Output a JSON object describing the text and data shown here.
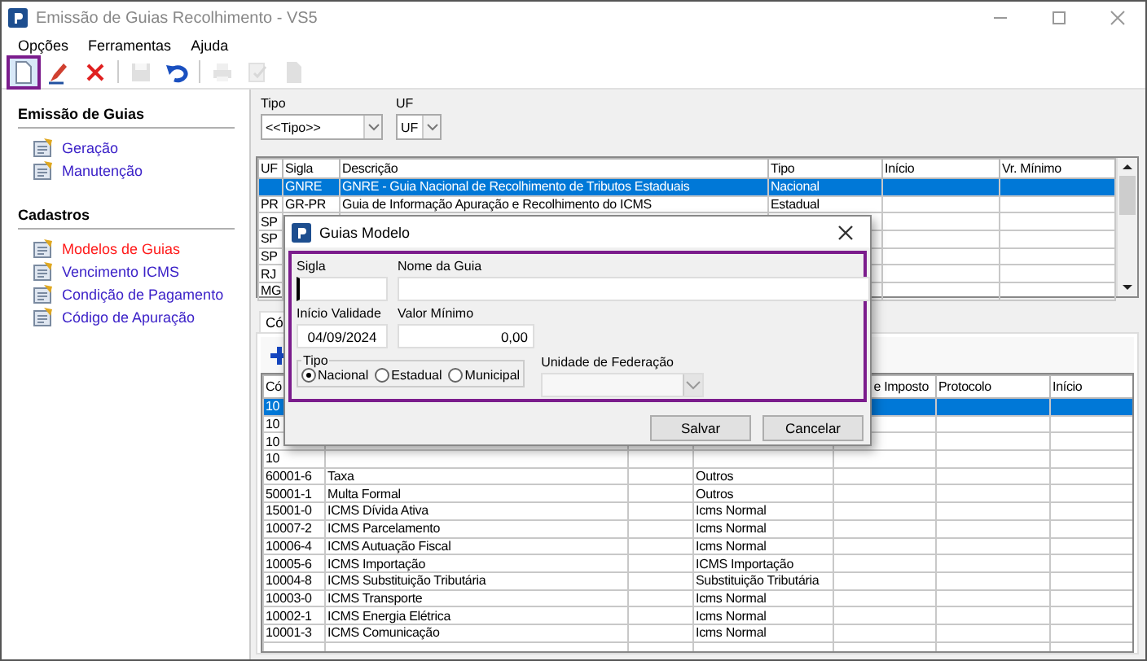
{
  "window": {
    "title": "Emissão de Guias Recolhimento - VS5"
  },
  "menu": [
    "Opções",
    "Ferramentas",
    "Ajuda"
  ],
  "toolbar": [
    {
      "disabled": false,
      "highlighted": true
    },
    {
      "disabled": false,
      "highlighted": false
    },
    {
      "disabled": false,
      "highlighted": false
    },
    {
      "disabled": true,
      "highlighted": false
    },
    {
      "disabled": false,
      "highlighted": false
    },
    {
      "disabled": true,
      "highlighted": false
    },
    {
      "disabled": true,
      "highlighted": false
    },
    {
      "disabled": true,
      "highlighted": false
    }
  ],
  "sidebar": [
    {
      "title": "Emissão de Guias",
      "items": [
        {
          "label": "Geração",
          "selected": false
        },
        {
          "label": "Manutenção",
          "selected": false
        }
      ]
    },
    {
      "title": "Cadastros",
      "items": [
        {
          "label": "Modelos de Guias",
          "selected": true
        },
        {
          "label": "Vencimento ICMS",
          "selected": false
        },
        {
          "label": "Condição de Pagamento",
          "selected": false
        },
        {
          "label": "Código de Apuração",
          "selected": false
        }
      ]
    }
  ],
  "filters": [
    {
      "label": "Tipo",
      "value": "<<Tipo>>"
    },
    {
      "label": "UF",
      "value": "UF"
    }
  ],
  "guides_table": {
    "columns": [
      "UF",
      "Sigla",
      "Descrição",
      "Tipo",
      "Início",
      "Vr. Mínimo"
    ],
    "rows": [
      {
        "sigla": "GNRE",
        "descricao": "GNRE - Guia Nacional de Recolhimento de Tributos Estaduais",
        "tipo": "Nacional",
        "selected": true
      },
      {
        "uf": "PR",
        "sigla": "GR-PR",
        "descricao": "Guia de Informação Apuração e Recolhimento do ICMS",
        "tipo": "Estadual",
        "selected": false
      },
      {
        "uf": "SP",
        "selected": false
      },
      {
        "uf": "SP",
        "selected": false
      },
      {
        "uf": "SP",
        "selected": false
      },
      {
        "uf": "RJ",
        "selected": false
      },
      {
        "uf": "MG",
        "selected": false
      }
    ]
  },
  "codes_tab": {
    "label": "Có"
  },
  "codes_table": {
    "columns": [
      {
        "label": "Có"
      },
      {},
      {},
      {},
      {
        "label": "e Imposto"
      },
      {
        "label": "Protocolo"
      },
      {
        "label": "Início"
      }
    ],
    "rows": [
      {
        "code": "10",
        "selected": true
      },
      {
        "code": "10",
        "selected": false
      },
      {
        "code": "10",
        "selected": false
      },
      {
        "code": "10",
        "selected": false
      },
      {
        "code": "60001-6",
        "description": "Taxa",
        "type": "Outros",
        "selected": false
      },
      {
        "code": "50001-1",
        "description": "Multa Formal",
        "type": "Outros",
        "selected": false
      },
      {
        "code": "15001-0",
        "description": "ICMS Dívida Ativa",
        "type": "Icms Normal",
        "selected": false
      },
      {
        "code": "10007-2",
        "description": "ICMS Parcelamento",
        "type": "Icms Normal",
        "selected": false
      },
      {
        "code": "10006-4",
        "description": "ICMS Autuação Fiscal",
        "type": "Icms Normal",
        "selected": false
      },
      {
        "code": "10005-6",
        "description": "ICMS Importação",
        "type": "ICMS Importação",
        "selected": false
      },
      {
        "code": "10004-8",
        "description": "ICMS Substituição Tributária",
        "type": "Substituição Tributária",
        "selected": false
      },
      {
        "code": "10003-0",
        "description": "ICMS Transporte",
        "type": "Icms Normal",
        "selected": false
      },
      {
        "code": "10002-1",
        "description": "ICMS Energia Elétrica",
        "type": "Icms Normal",
        "selected": false
      },
      {
        "code": "10001-3",
        "description": "ICMS Comunicação",
        "type": "Icms Normal",
        "selected": false
      }
    ]
  },
  "dialog": {
    "title": "Guias Modelo",
    "sigla": {
      "label": "Sigla"
    },
    "nome": {
      "label": "Nome da Guia"
    },
    "inicio": {
      "label": "Início Validade",
      "value": "04/09/2024"
    },
    "valor": {
      "label": "Valor Mínimo",
      "value": "0,00"
    },
    "tipo": {
      "label": "Tipo",
      "options": [
        {
          "label": "Nacional",
          "selected": true
        },
        {
          "label": "Estadual",
          "selected": false
        },
        {
          "label": "Municipal",
          "selected": false
        }
      ]
    },
    "uf": {
      "label": "Unidade de Federação",
      "disabled": true
    },
    "buttons": [
      "Salvar",
      "Cancelar"
    ]
  }
}
